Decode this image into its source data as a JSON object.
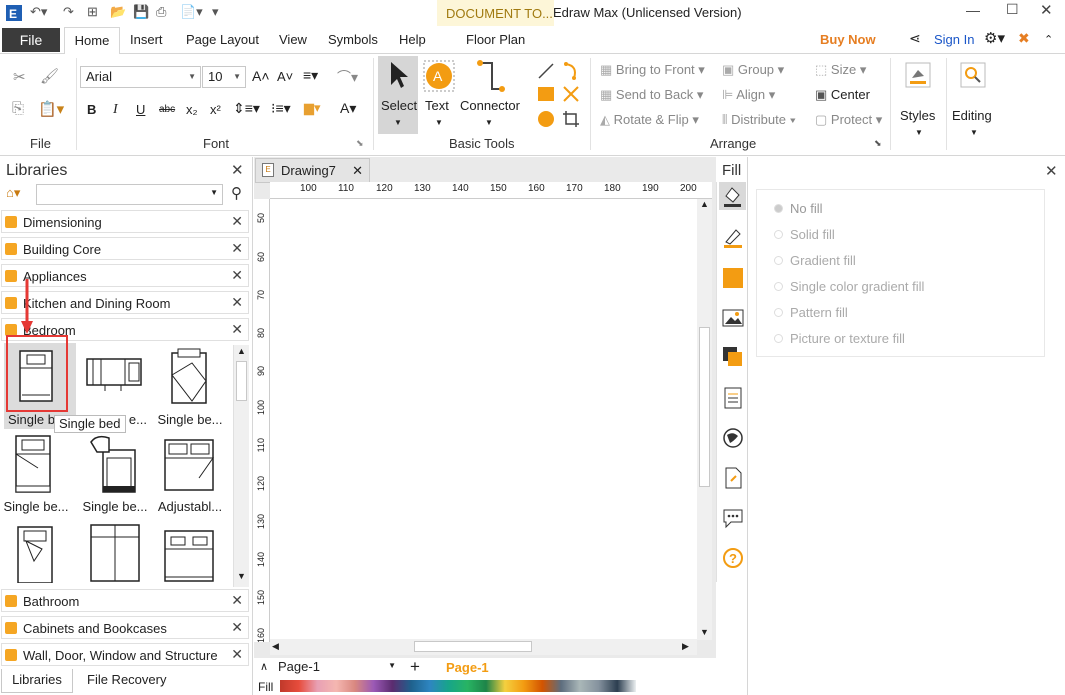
{
  "app": {
    "title": "Edraw Max (Unlicensed Version)",
    "context_tab_group": "DOCUMENT TO...",
    "buy_now": "Buy Now",
    "sign_in": "Sign In"
  },
  "tabs": [
    "File",
    "Home",
    "Insert",
    "Page Layout",
    "View",
    "Symbols",
    "Help",
    "Floor Plan"
  ],
  "ribbon": {
    "file_group": "File",
    "font": {
      "family": "Arial",
      "size": "10",
      "group": "Font"
    },
    "basic_tools": {
      "select": "Select",
      "text": "Text",
      "connector": "Connector",
      "group": "Basic Tools"
    },
    "arrange": {
      "bring_to_front": "Bring to Front",
      "send_to_back": "Send to Back",
      "rotate_flip": "Rotate & Flip",
      "group_btn": "Group",
      "align": "Align",
      "distribute": "Distribute",
      "size": "Size",
      "center": "Center",
      "protect": "Protect",
      "group": "Arrange"
    },
    "styles": "Styles",
    "editing": "Editing"
  },
  "libraries": {
    "title": "Libraries",
    "categories_top": [
      "Dimensioning",
      "Building Core",
      "Appliances",
      "Kitchen and Dining Room",
      "Bedroom"
    ],
    "shapes": [
      {
        "label": "Single b",
        "icon": "single-bed-icon"
      },
      {
        "label": "",
        "icon": "bunk-bed-icon"
      },
      {
        "label": "Single be...",
        "icon": "single-bed-pillow-icon"
      },
      {
        "label": "Single be...",
        "icon": "single-bed-footboard-icon"
      },
      {
        "label": "Single be...",
        "icon": "single-bed-headboard-icon"
      },
      {
        "label": "Adjustabl...",
        "icon": "adjustable-bed-icon"
      },
      {
        "label": "",
        "icon": "bed-with-pillows-icon"
      },
      {
        "label": "",
        "icon": "double-bed-icon"
      },
      {
        "label": "",
        "icon": "double-bed-pillows-icon"
      }
    ],
    "tooltip": "Single bed",
    "partial_label": "e...",
    "categories_bottom": [
      "Bathroom",
      "Cabinets and Bookcases",
      "Wall, Door, Window and Structure"
    ],
    "bottom_tabs": [
      "Libraries",
      "File Recovery"
    ]
  },
  "document": {
    "tab": "Drawing7",
    "ruler_h": [
      "100",
      "110",
      "120",
      "130",
      "140",
      "150",
      "160",
      "170",
      "180",
      "190",
      "200"
    ],
    "ruler_v": [
      "50",
      "60",
      "70",
      "80",
      "90",
      "100",
      "110",
      "120",
      "130",
      "140",
      "150",
      "160"
    ],
    "page_select": "Page-1",
    "page_tab": "Page-1",
    "fill_label": "Fill"
  },
  "fill_panel": {
    "title": "Fill",
    "options": [
      "No fill",
      "Solid fill",
      "Gradient fill",
      "Single color gradient fill",
      "Pattern fill",
      "Picture or texture fill"
    ],
    "selected": "No fill"
  },
  "colors": {
    "accent_orange": "#f39c12",
    "buy_now": "#e67e22",
    "sign_in": "#1a56c8",
    "highlight_red": "#e53935"
  }
}
